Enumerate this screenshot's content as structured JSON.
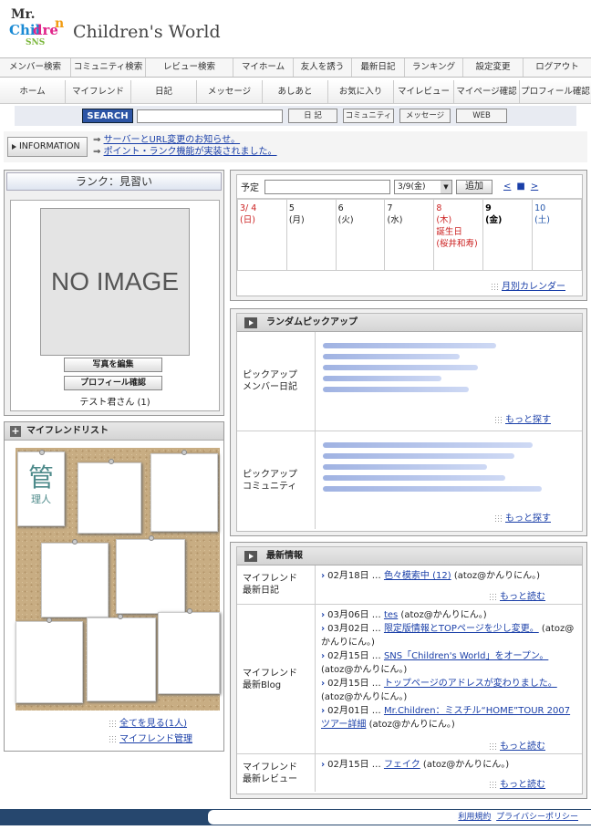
{
  "header": {
    "logo_text": [
      "Mr.",
      "Chil",
      "dre",
      "n",
      "SNS"
    ],
    "site_title": "Children's World"
  },
  "nav1": [
    "メンバー検索",
    "コミュニティ検索",
    "レビュー検索",
    "マイホーム",
    "友人を誘う",
    "最新日記",
    "ランキング",
    "設定変更",
    "ログアウト"
  ],
  "nav2": [
    "ホーム",
    "マイフレンド",
    "日記",
    "メッセージ",
    "あしあと",
    "お気に入り",
    "マイレビュー",
    "マイページ確認",
    "プロフィール確認"
  ],
  "search": {
    "button": "SEARCH",
    "options": [
      "日 記",
      "コミュニティ",
      "メッセージ",
      "WEB"
    ]
  },
  "information": {
    "label": "INFORMATION",
    "links": [
      "サーバーとURL変更のお知らせ。",
      "ポイント・ランク機能が実装されました。"
    ]
  },
  "profile": {
    "rank": "ランク：見習い",
    "no_image": "NO IMAGE",
    "edit_photo": "写真を編集",
    "profile_check": "プロフィール確認",
    "name": "テスト君さん (1)"
  },
  "friends": {
    "title": "マイフレンドリスト",
    "kanji_main": "管",
    "kanji_sub": "理人",
    "view_all": "全てを見る(1人)",
    "manage": "マイフレンド管理"
  },
  "schedule": {
    "label": "予定",
    "date_select": "3/9(金)",
    "add": "追加",
    "prev": "<",
    "cur": "■",
    "next": ">",
    "monthly": "月別カレンダー",
    "days": [
      {
        "date": "3/ 4",
        "dow": "(日)",
        "color": "#c22",
        "note": ""
      },
      {
        "date": "5",
        "dow": "(月)",
        "color": "#222",
        "note": ""
      },
      {
        "date": "6",
        "dow": "(火)",
        "color": "#222",
        "note": ""
      },
      {
        "date": "7",
        "dow": "(水)",
        "color": "#222",
        "note": ""
      },
      {
        "date": "8",
        "dow": "(木)",
        "color": "#c22",
        "note": "誕生日\n(桜井和寿)"
      },
      {
        "date": "9",
        "dow": "(金)",
        "color": "#000",
        "note": "",
        "bold": true
      },
      {
        "date": "10",
        "dow": "(土)",
        "color": "#2255aa",
        "note": ""
      }
    ]
  },
  "pickup": {
    "title": "ランダムピックアップ",
    "diary_label": "ピックアップ\nメンバー日記",
    "community_label": "ピックアップ\nコミュニティ",
    "more": "もっと探す"
  },
  "latest": {
    "title": "最新情報",
    "more": "もっと読む",
    "diary_label": "マイフレンド\n最新日記",
    "diary": [
      {
        "date": "02月18日",
        "title": "色々模索中 (12)",
        "author": "(atoz@かんりにん。)"
      }
    ],
    "blog_label": "マイフレンド\n最新Blog",
    "blog": [
      {
        "date": "03月06日",
        "title": "tes",
        "author": "(atoz@かんりにん。)"
      },
      {
        "date": "03月02日",
        "title": "限定版情報とTOPページを少し変更。",
        "author": "(atoz@かんりにん。)"
      },
      {
        "date": "02月15日",
        "title": "SNS「Children's World」をオープン。",
        "author": "(atoz@かんりにん。)"
      },
      {
        "date": "02月15日",
        "title": "トップページのアドレスが変わりました。",
        "author": "(atoz@かんりにん。)"
      },
      {
        "date": "02月01日",
        "title": "Mr.Children：ミスチル“HOME”TOUR 2007 ツアー詳細",
        "author": "(atoz@かんりにん。)"
      }
    ],
    "review_label": "マイフレンド\n最新レビュー",
    "review": [
      {
        "date": "02月15日",
        "title": "フェイク",
        "author": "(atoz@かんりにん。)"
      }
    ]
  },
  "footer": {
    "terms": "利用規約",
    "privacy": "プライバシーポリシー"
  }
}
